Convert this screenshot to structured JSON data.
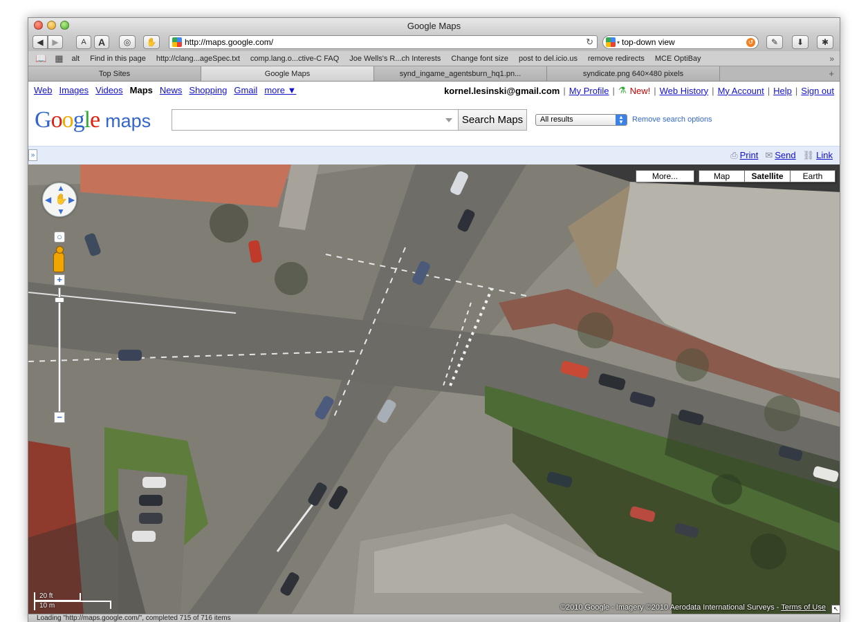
{
  "window": {
    "title": "Google Maps"
  },
  "toolbar": {
    "back_icon": "back-arrow-icon",
    "forward_icon": "forward-arrow-icon",
    "smaller_text": "A",
    "larger_text": "A",
    "url": "http://maps.google.com/",
    "search_query": "top-down view"
  },
  "bookmarks": [
    "alt",
    "Find in this page",
    "http://clang...ageSpec.txt",
    "comp.lang.o...ctive-C FAQ",
    "Joe Wells's R...ch Interests",
    "Change font size",
    "post to del.icio.us",
    "remove redirects",
    "MCE OptiBay"
  ],
  "tabs": [
    {
      "label": "Top Sites",
      "active": false
    },
    {
      "label": "Google Maps",
      "active": true
    },
    {
      "label": "synd_ingame_agentsburn_hq1.pn...",
      "active": false
    },
    {
      "label": "syndicate.png 640×480 pixels",
      "active": false
    }
  ],
  "gbar": {
    "links": [
      "Web",
      "Images",
      "Videos",
      "Maps",
      "News",
      "Shopping",
      "Gmail",
      "more ▼"
    ],
    "current": "Maps",
    "email": "kornel.lesinski@gmail.com",
    "my_profile": "My Profile",
    "new_label": "New!",
    "web_history": "Web History",
    "my_account": "My Account",
    "help": "Help",
    "sign_out": "Sign out"
  },
  "masthead": {
    "logo_letters": [
      "G",
      "o",
      "o",
      "g",
      "l",
      "e"
    ],
    "logo_colors": [
      "#3366cc",
      "#dd2211",
      "#eeaa00",
      "#3366cc",
      "#33aa33",
      "#dd2211"
    ],
    "maps_word": "maps",
    "search_value": "",
    "search_button": "Search Maps",
    "results_select": "All results",
    "remove_options": "Remove search options"
  },
  "actionbar": {
    "collapse": "»",
    "print": "Print",
    "send": "Send",
    "link": "Link"
  },
  "map": {
    "type_more": "More...",
    "types": [
      "Map",
      "Satellite",
      "Earth"
    ],
    "selected_type": "Satellite",
    "scale_imperial": "20 ft",
    "scale_metric": "10 m",
    "copyright": "©2010 Google - Imagery ©2010 Aerodata International Surveys - ",
    "terms": "Terms of Use"
  },
  "status": "Loading \"http://maps.google.com/\", completed 715 of 716 items"
}
